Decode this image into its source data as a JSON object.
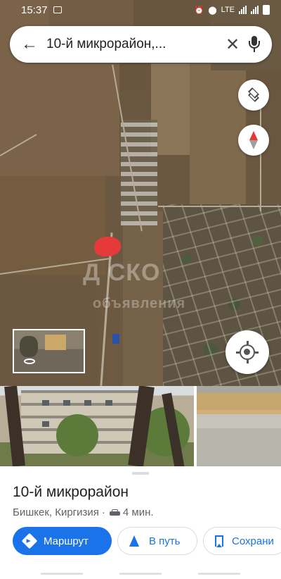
{
  "status_bar": {
    "time": "15:37",
    "network": "LTE"
  },
  "search": {
    "query": "10-й микрорайон,..."
  },
  "map": {
    "watermark_line1": "Д СКО",
    "watermark_line2": "объявления",
    "marker_color": "#e63a3a"
  },
  "place": {
    "name": "10-й микрорайон",
    "location": "Бишкек, Киргизия",
    "separator": "·",
    "drive_time": "4 мин."
  },
  "actions": {
    "directions_label": "Маршрут",
    "start_label": "В путь",
    "save_label": "Сохрани"
  },
  "colors": {
    "accent": "#1a73e8"
  }
}
